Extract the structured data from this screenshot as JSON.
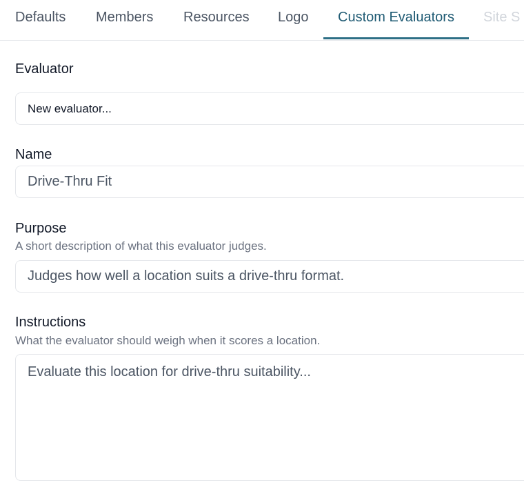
{
  "tabs": [
    {
      "label": "Defaults"
    },
    {
      "label": "Members"
    },
    {
      "label": "Resources"
    },
    {
      "label": "Logo"
    },
    {
      "label": "Custom Evaluators",
      "active": true
    },
    {
      "label": "Site S"
    }
  ],
  "evaluator": {
    "label": "Evaluator",
    "selected": "New evaluator..."
  },
  "name": {
    "label": "Name",
    "value": "Drive-Thru Fit"
  },
  "purpose": {
    "label": "Purpose",
    "hint": "A short description of what this evaluator judges.",
    "value": "Judges how well a location suits a drive-thru format."
  },
  "instructions": {
    "label": "Instructions",
    "hint": "What the evaluator should weigh when it scores a location.",
    "value": "Evaluate this location for drive-thru suitability..."
  },
  "colors": {
    "active_tab": "#1e5a73",
    "tab_underline": "#2d6f86",
    "border": "#e5e7eb"
  }
}
